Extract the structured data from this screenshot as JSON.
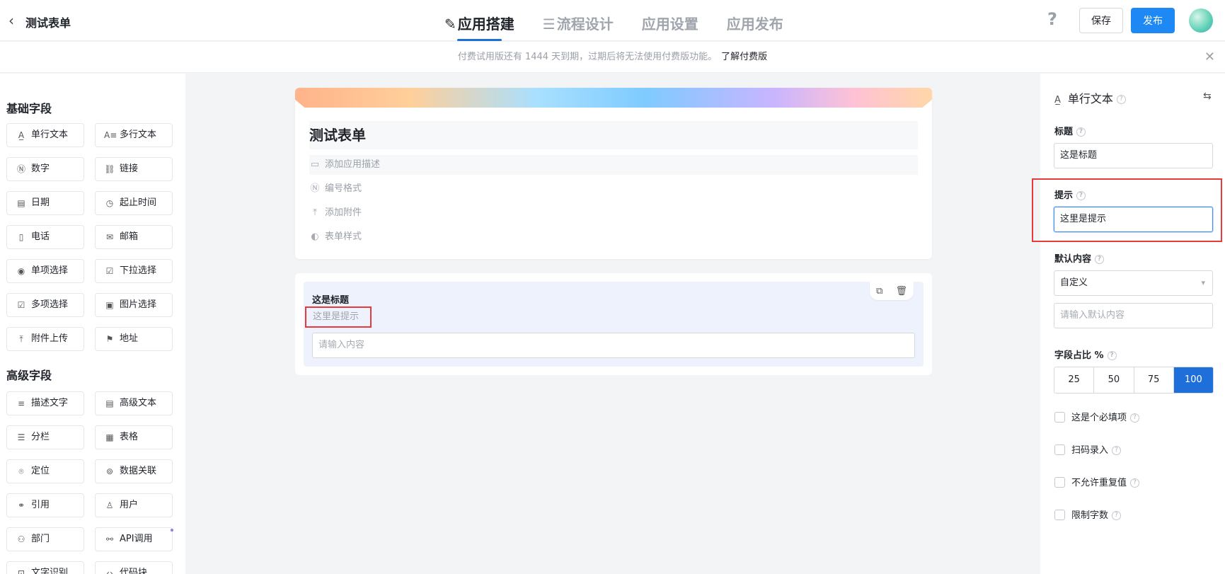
{
  "header": {
    "back_icon": "chevron-left-icon",
    "title": "测试表单",
    "tabs": [
      {
        "label": "应用搭建",
        "icon": "edit-icon",
        "glyph": "✎",
        "active": true
      },
      {
        "label": "流程设计",
        "icon": "flow-lines-icon",
        "glyph": "☰",
        "active": false
      },
      {
        "label": "应用设置",
        "icon": "",
        "glyph": "",
        "active": false
      },
      {
        "label": "应用发布",
        "icon": "",
        "glyph": "",
        "active": false
      }
    ],
    "help_icon": "question-icon",
    "save_label": "保存",
    "publish_label": "发布"
  },
  "banner": {
    "text": "付费试用版还有 1444 天到期，过期后将无法使用付费版功能。",
    "link": "了解付费版"
  },
  "left": {
    "basic_title": "基础字段",
    "basic_fields": [
      {
        "label": "单行文本",
        "glyph": "A̲"
      },
      {
        "label": "多行文本",
        "glyph": "A≡"
      },
      {
        "label": "数字",
        "glyph": "Ⓝ"
      },
      {
        "label": "链接",
        "glyph": "⛓"
      },
      {
        "label": "日期",
        "glyph": "▤"
      },
      {
        "label": "起止时间",
        "glyph": "◷"
      },
      {
        "label": "电话",
        "glyph": "▯"
      },
      {
        "label": "邮箱",
        "glyph": "✉"
      },
      {
        "label": "单项选择",
        "glyph": "◉"
      },
      {
        "label": "下拉选择",
        "glyph": "☑"
      },
      {
        "label": "多项选择",
        "glyph": "☑"
      },
      {
        "label": "图片选择",
        "glyph": "▣"
      },
      {
        "label": "附件上传",
        "glyph": "⤒"
      },
      {
        "label": "地址",
        "glyph": "⚑"
      }
    ],
    "advanced_title": "高级字段",
    "advanced_fields": [
      {
        "label": "描述文字",
        "glyph": "≡"
      },
      {
        "label": "高级文本",
        "glyph": "▤"
      },
      {
        "label": "分栏",
        "glyph": "☰"
      },
      {
        "label": "表格",
        "glyph": "▦"
      },
      {
        "label": "定位",
        "glyph": "⌾"
      },
      {
        "label": "数据关联",
        "glyph": "⊚"
      },
      {
        "label": "引用",
        "glyph": "⚭"
      },
      {
        "label": "用户",
        "glyph": "♙"
      },
      {
        "label": "部门",
        "glyph": "⚇"
      },
      {
        "label": "API调用",
        "glyph": "⚯"
      },
      {
        "label": "文字识别",
        "glyph": "⊡"
      },
      {
        "label": "代码块",
        "glyph": "‹›"
      }
    ]
  },
  "form": {
    "name": "测试表单",
    "rows": [
      {
        "label": "添加应用描述",
        "glyph": "▭",
        "icon": "comment-icon"
      },
      {
        "label": "编号格式",
        "glyph": "Ⓝ",
        "icon": "number-format-icon"
      },
      {
        "label": "添加附件",
        "glyph": "⤒",
        "icon": "upload-icon"
      },
      {
        "label": "表单样式",
        "glyph": "◐",
        "icon": "palette-icon"
      }
    ],
    "field": {
      "title": "这是标题",
      "hint": "这里是提示",
      "placeholder": "请输入内容"
    }
  },
  "right": {
    "heading": "单行文本",
    "title_label": "标题",
    "title_value": "这是标题",
    "hint_label": "提示",
    "hint_value": "这里是提示",
    "default_label": "默认内容",
    "default_select": "自定义",
    "default_placeholder": "请输入默认内容",
    "width_label": "字段占比 %",
    "width_options": [
      "25",
      "50",
      "75",
      "100"
    ],
    "width_selected": "100",
    "checkboxes": [
      {
        "label": "这是个必填项",
        "checked": false
      },
      {
        "label": "扫码录入",
        "checked": false
      },
      {
        "label": "不允许重复值",
        "checked": false
      },
      {
        "label": "限制字数",
        "checked": false
      }
    ]
  },
  "colors": {
    "accent": "#1e6fd9",
    "publish": "#1e88f5",
    "highlight": "#e83a3a"
  }
}
